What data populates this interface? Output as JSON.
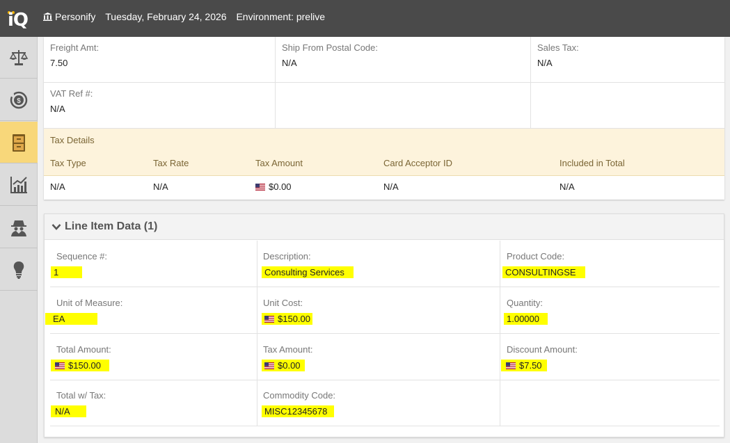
{
  "topbar": {
    "logo": "iQ",
    "org": "Personify",
    "date": "Tuesday, February 24, 2026",
    "environment": "Environment: prelive"
  },
  "sidebar": {
    "items": [
      {
        "icon": "scales-icon",
        "active": false
      },
      {
        "icon": "refund-dollar-icon",
        "active": false
      },
      {
        "icon": "archive-cabinet-icon",
        "active": true
      },
      {
        "icon": "chart-icon",
        "active": false
      },
      {
        "icon": "spy-icon",
        "active": false
      },
      {
        "icon": "lightbulb-icon",
        "active": false
      }
    ]
  },
  "details": {
    "freight_amt_label": "Freight Amt:",
    "freight_amt_value": "7.50",
    "ship_from_label": "Ship From Postal Code:",
    "ship_from_value": "N/A",
    "sales_tax_label": "Sales Tax:",
    "sales_tax_value": "N/A",
    "vat_ref_label": "VAT Ref #:",
    "vat_ref_value": "N/A"
  },
  "tax_details": {
    "title": "Tax Details",
    "columns": [
      "Tax Type",
      "Tax Rate",
      "Tax Amount",
      "Card Acceptor ID",
      "Included in Total"
    ],
    "row": [
      "N/A",
      "N/A",
      "$0.00",
      "N/A",
      "N/A"
    ]
  },
  "line_items": {
    "title": "Line Item Data (1)",
    "sequence_label": "Sequence #:",
    "sequence_value": "1",
    "description_label": "Description:",
    "description_value": "Consulting Services",
    "product_code_label": "Product Code:",
    "product_code_value": "CONSULTINGSE",
    "uom_label": "Unit of Measure:",
    "uom_value": "EA",
    "unit_cost_label": "Unit Cost:",
    "unit_cost_value": "$150.00",
    "quantity_label": "Quantity:",
    "quantity_value": "1.00000",
    "total_amount_label": "Total Amount:",
    "total_amount_value": "$150.00",
    "tax_amount_label": "Tax Amount:",
    "tax_amount_value": "$0.00",
    "discount_label": "Discount Amount:",
    "discount_value": "$7.50",
    "total_w_tax_label": "Total w/ Tax:",
    "total_w_tax_value": "N/A",
    "commodity_label": "Commodity Code:",
    "commodity_value": "MISC12345678"
  },
  "colors": {
    "topbar": "#4a4a4a",
    "active_nav": "#f8d77a",
    "tax_header_bg": "#fdf3dc",
    "highlight": "#ffff00"
  }
}
